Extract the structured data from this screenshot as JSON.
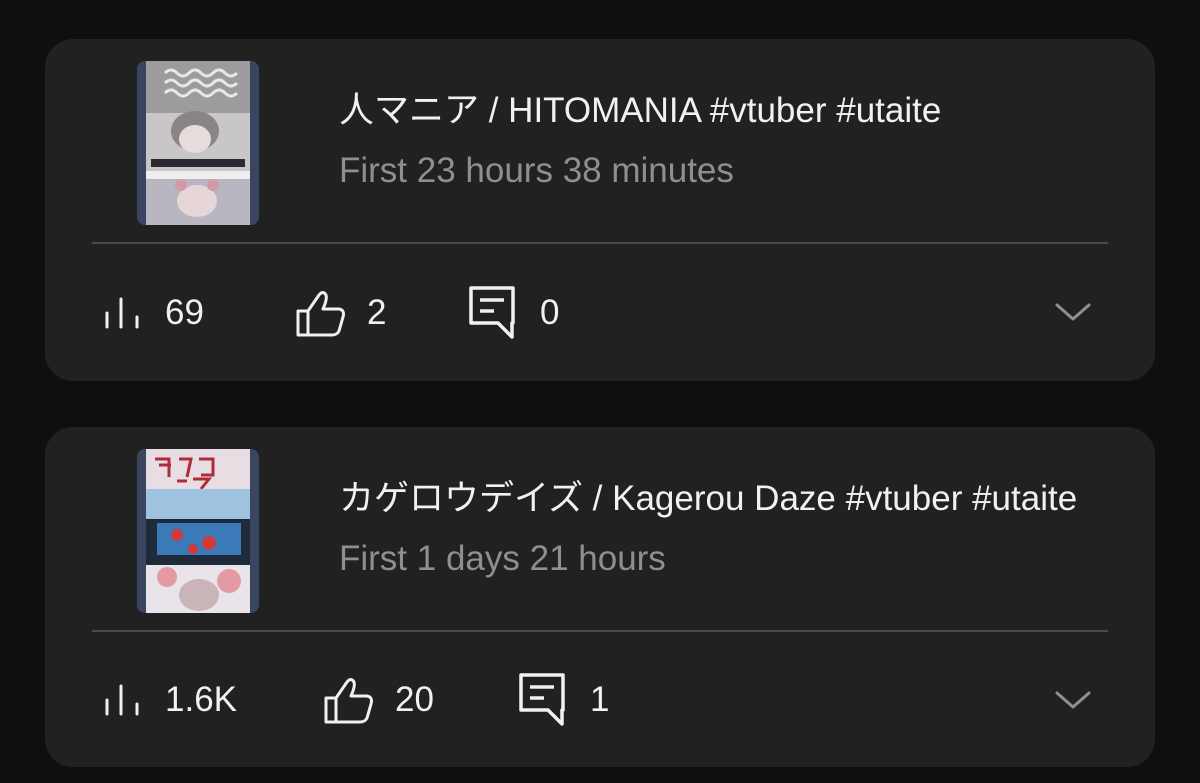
{
  "videos": [
    {
      "title": "人マニア / HITOMANIA #vtuber  #utaite",
      "subtitle": "First 23 hours 38 minutes",
      "views": "69",
      "likes": "2",
      "comments": "0",
      "thumbnail_icon": "video-thumbnail-hitomania"
    },
    {
      "title": "カゲロウデイズ / Kagerou Daze #vtuber  #utaite",
      "subtitle": "First 1 days 21 hours",
      "views": "1.6K",
      "likes": "20",
      "comments": "1",
      "thumbnail_icon": "video-thumbnail-kagerou-daze"
    }
  ],
  "icons": {
    "views": "bar-chart-icon",
    "likes": "thumbs-up-icon",
    "comments": "comment-icon",
    "expand": "chevron-down-icon"
  },
  "colors": {
    "background": "#0f0f0f",
    "card": "#212121",
    "title": "#f1f1f1",
    "subtitle": "#8f8f8f",
    "divider": "#4a4a4a"
  }
}
